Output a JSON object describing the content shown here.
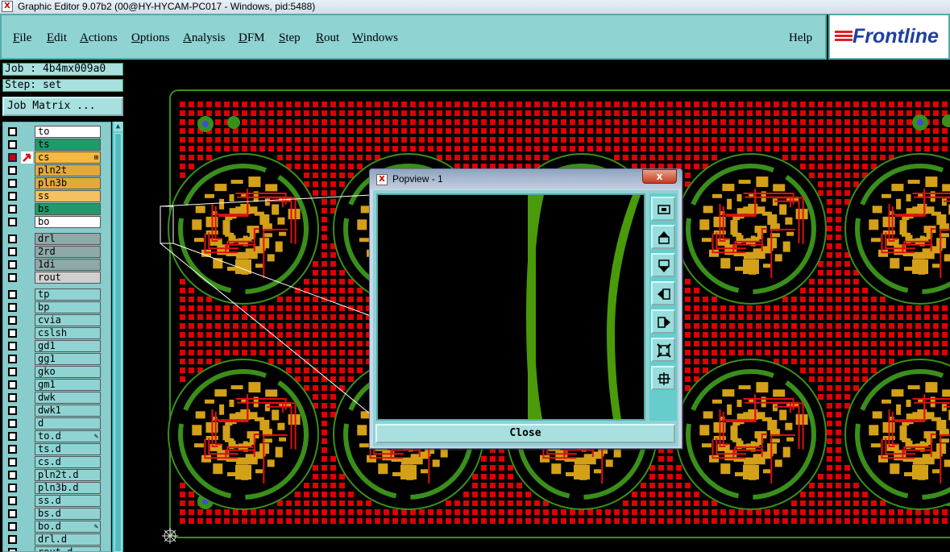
{
  "window": {
    "title": "Graphic Editor 9.07b2 (00@HY-HYCAM-PC017 - Windows, pid:5488)",
    "app_icon_glyph": "X"
  },
  "menubar": {
    "items": [
      {
        "label": "File",
        "mnemonic": "F"
      },
      {
        "label": "Edit",
        "mnemonic": "E"
      },
      {
        "label": "Actions",
        "mnemonic": "A"
      },
      {
        "label": "Options",
        "mnemonic": "O"
      },
      {
        "label": "Analysis",
        "mnemonic": "A"
      },
      {
        "label": "DFM",
        "mnemonic": "D"
      },
      {
        "label": "Step",
        "mnemonic": "S"
      },
      {
        "label": "Rout",
        "mnemonic": "R"
      },
      {
        "label": "Windows",
        "mnemonic": "W"
      }
    ],
    "help": "Help"
  },
  "logo": {
    "text": "Frontline"
  },
  "job": {
    "label": "Job : 4b4mx009a0"
  },
  "step": {
    "label": "Step: set"
  },
  "job_matrix": {
    "label": "Job Matrix ..."
  },
  "layers": [
    {
      "name": "to",
      "color": "#ffffff"
    },
    {
      "name": "ts",
      "color": "#1f9a6a"
    },
    {
      "name": "cs",
      "color": "#f5b840",
      "active": true,
      "marker": "⊞"
    },
    {
      "name": "pln2t",
      "color": "#e2a93a"
    },
    {
      "name": "pln3b",
      "color": "#e2a93a"
    },
    {
      "name": "ss",
      "color": "#f5c060"
    },
    {
      "name": "bs",
      "color": "#1f9a6a"
    },
    {
      "name": "bo",
      "color": "#ffffff"
    },
    {
      "name": "drl",
      "color": "#8fa8a8"
    },
    {
      "name": "2rd",
      "color": "#8fa8a8"
    },
    {
      "name": "1di",
      "color": "#8fa8a8"
    },
    {
      "name": "rout",
      "color": "#d0d0d0"
    },
    {
      "name": "tp",
      "color": "#8fd3d3"
    },
    {
      "name": "bp",
      "color": "#8fd3d3"
    },
    {
      "name": "cvia",
      "color": "#8fd3d3"
    },
    {
      "name": "cslsh",
      "color": "#8fd3d3"
    },
    {
      "name": "gd1",
      "color": "#8fd3d3"
    },
    {
      "name": "gg1",
      "color": "#8fd3d3"
    },
    {
      "name": "gko",
      "color": "#8fd3d3"
    },
    {
      "name": "gm1",
      "color": "#8fd3d3"
    },
    {
      "name": "dwk",
      "color": "#8fd3d3"
    },
    {
      "name": "dwk1",
      "color": "#8fd3d3"
    },
    {
      "name": "d",
      "color": "#8fd3d3"
    },
    {
      "name": "to.d",
      "color": "#8fd3d3",
      "marker": "✎"
    },
    {
      "name": "ts.d",
      "color": "#8fd3d3"
    },
    {
      "name": "cs.d",
      "color": "#8fd3d3"
    },
    {
      "name": "pln2t.d",
      "color": "#8fd3d3"
    },
    {
      "name": "pln3b.d",
      "color": "#8fd3d3"
    },
    {
      "name": "ss.d",
      "color": "#8fd3d3"
    },
    {
      "name": "bs.d",
      "color": "#8fd3d3"
    },
    {
      "name": "bo.d",
      "color": "#8fd3d3",
      "marker": "✎"
    },
    {
      "name": "drl.d",
      "color": "#8fd3d3"
    },
    {
      "name": "rout.d",
      "color": "#8fd3d3"
    }
  ],
  "popview": {
    "title": "Popview - 1",
    "close_glyph": "x",
    "close_button": "Close",
    "tools": [
      "zoom-fit-icon",
      "pan-up-icon",
      "pan-down-icon",
      "pan-left-icon",
      "pan-right-icon",
      "zoom-out-icon",
      "zoom-in-icon"
    ]
  },
  "colors": {
    "panel": "#8fd3d3",
    "copper": "#d4a017",
    "pads": "#e00000",
    "outline": "#3a8f1a",
    "trace": "#4a9a0a"
  }
}
